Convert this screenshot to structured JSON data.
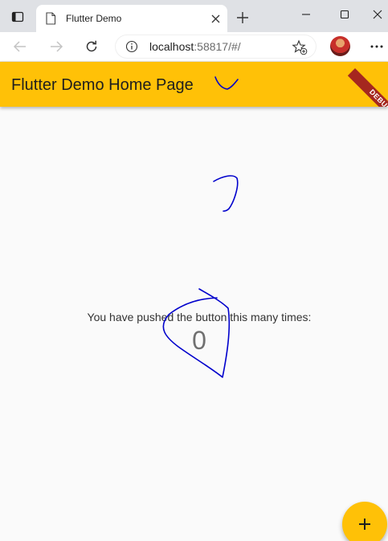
{
  "browser": {
    "tab": {
      "title": "Flutter Demo",
      "favicon": "page-icon",
      "close_icon": "close-icon"
    },
    "new_tab_icon": "plus-icon",
    "window_controls": [
      "minimize-icon",
      "maximize-icon",
      "close-icon"
    ],
    "address": {
      "host": "localhost",
      "rest": ":58817/#/",
      "info_icon": "info-icon"
    },
    "nav_icons": [
      "back-arrow-icon",
      "forward-arrow-icon",
      "refresh-icon"
    ],
    "favorites_icon": "star-add-icon",
    "menu_icon": "more-dots-icon"
  },
  "app": {
    "title": "Flutter Demo Home Page",
    "debug_banner": "DEBUG",
    "counter_label": "You have pushed the button this many times:",
    "counter_value": "0",
    "fab_icon": "plus-icon"
  },
  "colors": {
    "appbar": "#ffc107",
    "debug_banner": "#a5271f",
    "scribble": "#0000cc",
    "tabstrip": "#dfe1e5"
  }
}
